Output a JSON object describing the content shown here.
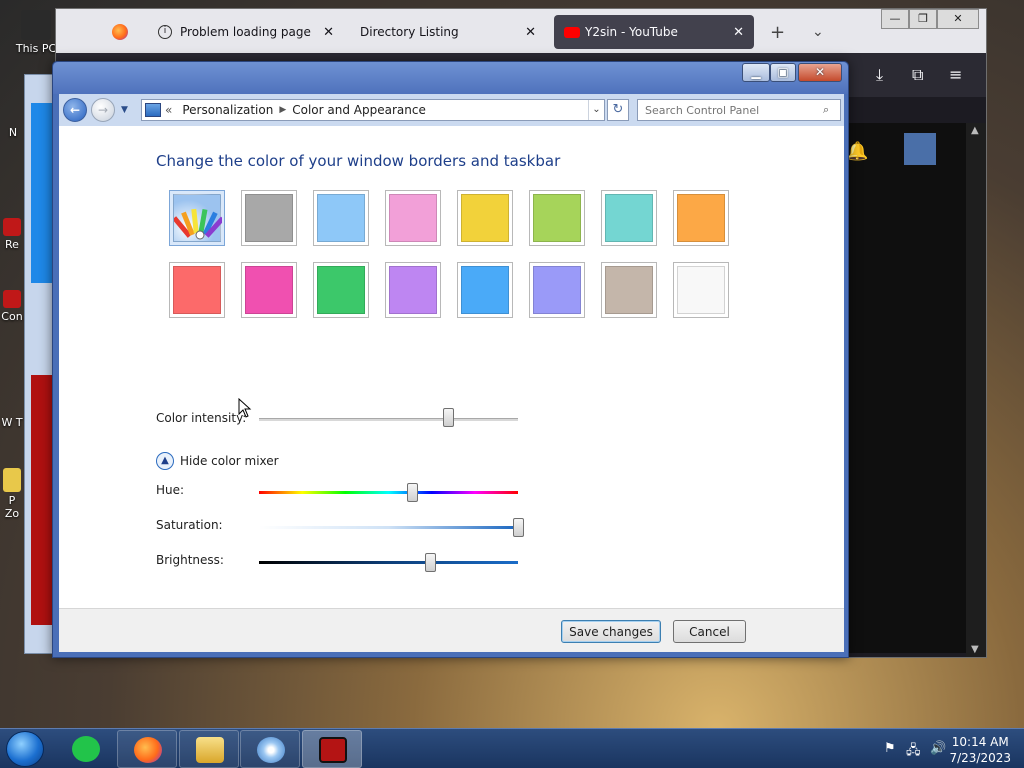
{
  "desktop": {
    "icons": [
      {
        "label": "This PC"
      },
      {
        "label": "N"
      },
      {
        "label": "Re"
      },
      {
        "label": "Con"
      },
      {
        "label": "W T"
      },
      {
        "label": "P Zo"
      }
    ]
  },
  "browser": {
    "tabs": [
      {
        "label": ""
      },
      {
        "label": "Problem loading page",
        "close": "✕"
      },
      {
        "label": "Directory Listing",
        "close": "✕"
      },
      {
        "label": "Y2sin - YouTube",
        "close": "✕"
      }
    ],
    "new_tab": "+",
    "list_tabs": "⌄"
  },
  "control_panel": {
    "breadcrumb": {
      "lead": "«",
      "items": [
        "Personalization",
        "Color and Appearance"
      ]
    },
    "search_placeholder": "Search Control Panel",
    "heading": "Change the color of your window borders and taskbar",
    "swatches": [
      {
        "name": "custom",
        "color": "#9cc3ef"
      },
      {
        "name": "gray",
        "color": "#a8a8a8"
      },
      {
        "name": "sky",
        "color": "#8ec8f8"
      },
      {
        "name": "pink",
        "color": "#f2a0d8"
      },
      {
        "name": "yellow",
        "color": "#f2d23a"
      },
      {
        "name": "lime",
        "color": "#a6d45a"
      },
      {
        "name": "teal",
        "color": "#74d6d2"
      },
      {
        "name": "orange",
        "color": "#fca846"
      },
      {
        "name": "red",
        "color": "#fc6a6a"
      },
      {
        "name": "magenta",
        "color": "#f050b0"
      },
      {
        "name": "green",
        "color": "#3cc86a"
      },
      {
        "name": "violet",
        "color": "#be86f2"
      },
      {
        "name": "blue",
        "color": "#4aaaf8"
      },
      {
        "name": "periwinkle",
        "color": "#9a9af8"
      },
      {
        "name": "taupe",
        "color": "#c4b6aa"
      },
      {
        "name": "white",
        "color": "#f8f8f8"
      }
    ],
    "selected_swatch": 0,
    "color_intensity_label": "Color intensity:",
    "color_intensity": 0.73,
    "hide_mixer_label": "Hide color mixer",
    "hue_label": "Hue:",
    "hue": 0.59,
    "saturation_label": "Saturation:",
    "saturation": 1.0,
    "brightness_label": "Brightness:",
    "brightness": 0.66,
    "save_label": "Save changes",
    "cancel_label": "Cancel"
  },
  "taskbar": {
    "time": "10:14 AM",
    "date": "7/23/2023"
  }
}
